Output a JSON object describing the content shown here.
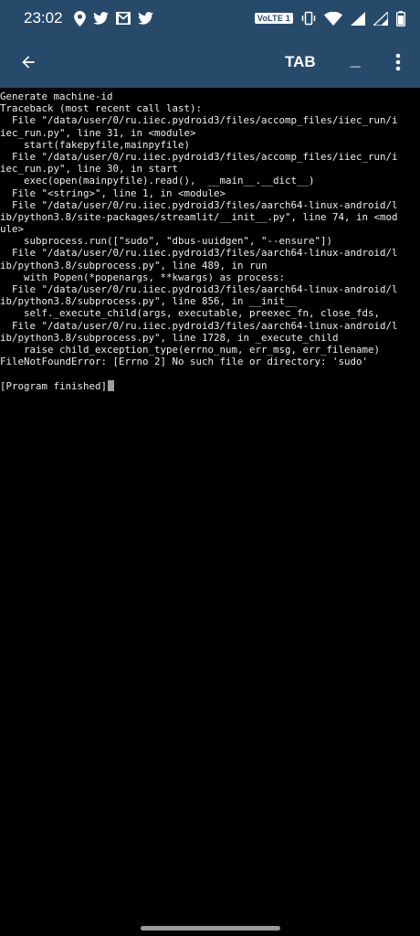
{
  "status_bar": {
    "time": "23:02",
    "volte_label": "VoLTE 1",
    "left_icons": [
      "location-icon",
      "twitter-icon",
      "gmail-icon",
      "twitter-icon"
    ],
    "right_icons": [
      "vibrate-icon",
      "wifi-icon",
      "signal-icon",
      "signal-icon",
      "battery-icon"
    ],
    "background": "#274a6b"
  },
  "app_bar": {
    "back_icon": "arrow-back-icon",
    "tab_label": "TAB",
    "underscore_label": "_",
    "overflow_icon": "more-vert-icon",
    "background": "#274a6b"
  },
  "terminal": {
    "lines": [
      "Generate machine-id",
      "Traceback (most recent call last):",
      "  File \"/data/user/0/ru.iiec.pydroid3/files/accomp_files/iiec_run/i",
      "iec_run.py\", line 31, in <module>",
      "    start(fakepyfile,mainpyfile)",
      "  File \"/data/user/0/ru.iiec.pydroid3/files/accomp_files/iiec_run/i",
      "iec_run.py\", line 30, in start",
      "    exec(open(mainpyfile).read(),  __main__.__dict__)",
      "  File \"<string>\", line 1, in <module>",
      "  File \"/data/user/0/ru.iiec.pydroid3/files/aarch64-linux-android/l",
      "ib/python3.8/site-packages/streamlit/__init__.py\", line 74, in <mod",
      "ule>",
      "    subprocess.run([\"sudo\", \"dbus-uuidgen\", \"--ensure\"])",
      "  File \"/data/user/0/ru.iiec.pydroid3/files/aarch64-linux-android/l",
      "ib/python3.8/subprocess.py\", line 489, in run",
      "    with Popen(*popenargs, **kwargs) as process:",
      "  File \"/data/user/0/ru.iiec.pydroid3/files/aarch64-linux-android/l",
      "ib/python3.8/subprocess.py\", line 856, in __init__",
      "    self._execute_child(args, executable, preexec_fn, close_fds,",
      "  File \"/data/user/0/ru.iiec.pydroid3/files/aarch64-linux-android/l",
      "ib/python3.8/subprocess.py\", line 1728, in _execute_child",
      "    raise child_exception_type(errno_num, err_msg, err_filename)",
      "FileNotFoundError: [Errno 2] No such file or directory: 'sudo'",
      "",
      "[Program finished]"
    ],
    "text_color": "#eeeeee",
    "cursor_color": "#9e9e9e"
  }
}
